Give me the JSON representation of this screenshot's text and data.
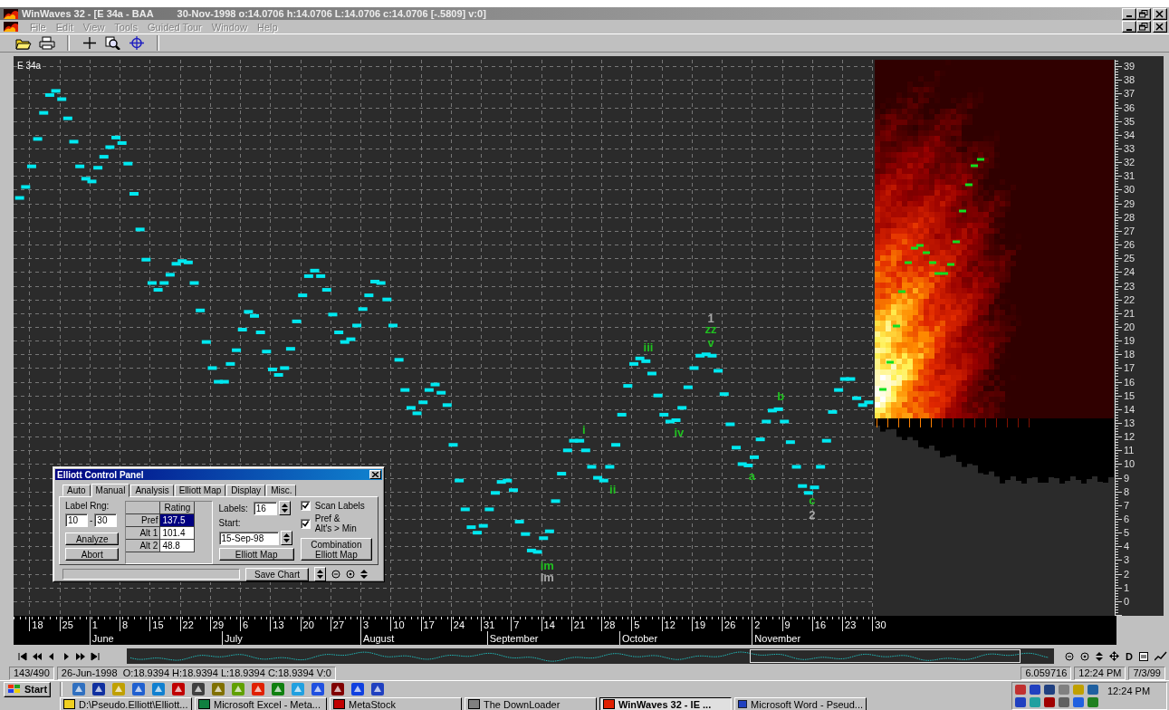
{
  "window": {
    "title": "WinWaves 32 - [E 34a - BAA",
    "title_info": "30-Nov-1998 o:14.0706 h:14.0706 L:14.0706 c:14.0706 [-.5809] v:0]"
  },
  "menu": [
    {
      "label": "File",
      "disabled": true
    },
    {
      "label": "Edit",
      "disabled": true
    },
    {
      "label": "View",
      "disabled": true
    },
    {
      "label": "Tools",
      "disabled": true
    },
    {
      "label": "Guided Tour",
      "disabled": true
    },
    {
      "label": "Window",
      "disabled": true
    },
    {
      "label": "Help",
      "disabled": true
    }
  ],
  "chart": {
    "title": "E 34a",
    "y_axis_labels": [
      "39",
      "38",
      "37",
      "36",
      "35",
      "34",
      "33",
      "32",
      "31",
      "30",
      "29",
      "28",
      "27",
      "26",
      "25",
      "24",
      "23",
      "22",
      "21",
      "20",
      "19",
      "18",
      "17",
      "16",
      "15",
      "14",
      "13",
      "12",
      "11",
      "10",
      "9",
      "8",
      "7",
      "6",
      "5",
      "4",
      "3",
      "2",
      "1",
      "0"
    ],
    "wave_labels": [
      {
        "text": "i",
        "color": "#20c020"
      },
      {
        "text": "ii",
        "color": "#20c020"
      },
      {
        "text": "iii",
        "color": "#20c020"
      },
      {
        "text": "iv",
        "color": "#20c020"
      },
      {
        "text": "1",
        "color": "#a8a8a8"
      },
      {
        "text": "zz",
        "color": "#20c020"
      },
      {
        "text": "v",
        "color": "#20c020"
      },
      {
        "text": "a",
        "color": "#20c020"
      },
      {
        "text": "b",
        "color": "#20c020"
      },
      {
        "text": "c",
        "color": "#20c020"
      },
      {
        "text": "2",
        "color": "#a8a8a8"
      },
      {
        "text": "im",
        "color": "#20c020"
      },
      {
        "text": "Im",
        "color": "#a8a8a8"
      }
    ],
    "date_labels": [
      "18",
      "25",
      "1",
      "8",
      "15",
      "22",
      "29",
      "6",
      "13",
      "20",
      "27",
      "3",
      "10",
      "17",
      "24",
      "31",
      "7",
      "14",
      "21",
      "28",
      "5",
      "12",
      "19",
      "26",
      "2",
      "9",
      "16",
      "23",
      "30"
    ],
    "months": [
      {
        "label": "June"
      },
      {
        "label": "July"
      },
      {
        "label": "August"
      },
      {
        "label": "September"
      },
      {
        "label": "October"
      },
      {
        "label": "November"
      }
    ]
  },
  "control_panel": {
    "title": "Elliott Control Panel",
    "tabs": [
      {
        "label": "Auto",
        "selected": false
      },
      {
        "label": "Manual",
        "selected": true
      },
      {
        "label": "Analysis",
        "selected": false
      },
      {
        "label": "Elliott Map",
        "selected": false
      },
      {
        "label": "Display",
        "selected": false
      },
      {
        "label": "Misc.",
        "selected": false
      }
    ],
    "label_range": {
      "label": "Label Rng:",
      "from": "10",
      "separator": "-",
      "to": "30"
    },
    "analyze_button": "Analyze",
    "abort_button": "Abort",
    "ratings": {
      "header": "Rating",
      "rows": [
        {
          "name": "Pref",
          "value": "137.5",
          "selected": true
        },
        {
          "name": "Alt 1",
          "value": "101.4",
          "selected": false
        },
        {
          "name": "Alt 2",
          "value": "48.8",
          "selected": false
        }
      ]
    },
    "labels_field": {
      "label": "Labels:",
      "value": "16"
    },
    "start_field": {
      "label": "Start:",
      "value": "15-Sep-98"
    },
    "elliott_map_button": "Elliott Map",
    "checkboxes": [
      {
        "label": "Scan Labels",
        "checked": true
      },
      {
        "label": "Pref &\nAlt's > Min",
        "checked": true
      }
    ],
    "combination_button": "Combination Elliott Map",
    "progress": {
      "level": 0
    },
    "save_chart_button": "Save Chart"
  },
  "navigator": {
    "tool_letter": "D"
  },
  "status_bar": {
    "record": "143/490",
    "quote": "26-Jun-1998  O:18.9394 H:18.9394 L:18.9394 C:18.9394 V:0",
    "value": "6.059716",
    "time": "12:24 PM",
    "date": "7/3/99"
  },
  "taskbar": {
    "start": "Start",
    "tasks": [
      {
        "label": "D:\\Pseudo.Elliott\\Elliott...",
        "selected": false
      },
      {
        "label": "Microsoft Excel - Meta...",
        "selected": false
      },
      {
        "label": "MetaStock",
        "selected": false
      },
      {
        "label": "The DownLoader",
        "selected": false
      },
      {
        "label": "WinWaves 32 - IE ...",
        "selected": true
      },
      {
        "label": "Microsoft Word - Pseud...",
        "selected": false
      }
    ],
    "clock": "12:24 PM"
  }
}
